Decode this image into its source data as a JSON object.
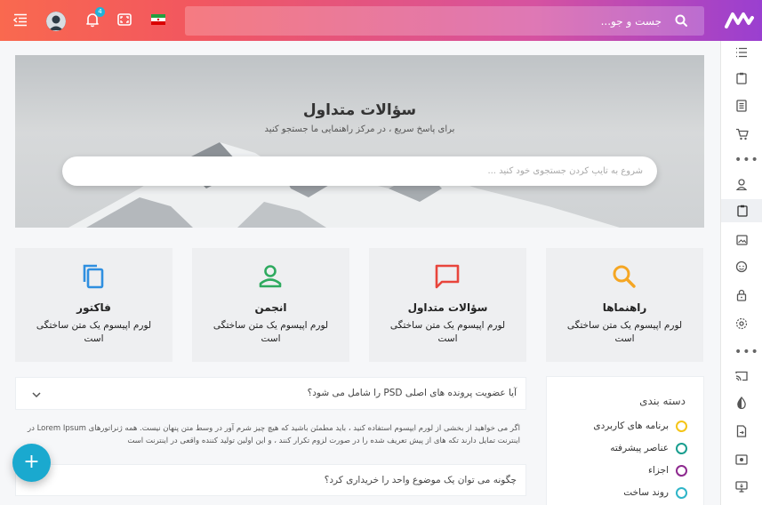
{
  "header": {
    "search_placeholder": "جست و جو...",
    "notification_count": "4",
    "colors": {
      "gradient_start": "#f9694f",
      "gradient_end": "#9a3fd0"
    },
    "icons": [
      "logo",
      "search-icon",
      "language-flag-iran",
      "fullscreen-icon",
      "bell-icon",
      "avatar",
      "menu-toggle-icon"
    ]
  },
  "sidebar": {
    "icons": [
      "list-icon",
      "clipboard-icon",
      "document-icon",
      "cart-icon",
      "more-dots",
      "user-icon",
      "clipboard-icon",
      "image-icon",
      "face-icon",
      "lock-icon",
      "settings-icon",
      "more-dots",
      "cast-icon",
      "contrast-icon",
      "file-export-icon",
      "card-icon",
      "monitor-icon"
    ],
    "active_index": 6
  },
  "hero": {
    "title": "سؤالات متداول",
    "subtitle": "برای پاسخ سریع ، در مرکز راهنمایی ما جستجو کنید",
    "search_placeholder": "شروع به تایپ کردن جستجوی خود کنید ..."
  },
  "cards": [
    {
      "title": "راهنماها",
      "text": "لورم اپیسوم یک متن ساختگی است",
      "icon": "search-icon",
      "color": "#f5a623"
    },
    {
      "title": "سؤالات متداول",
      "text": "لورم اپیسوم یک متن ساختگی است",
      "icon": "chat-icon",
      "color": "#e8453c"
    },
    {
      "title": "انجمن",
      "text": "لورم اپیسوم یک متن ساختگی است",
      "icon": "user-icon",
      "color": "#2eaa5f"
    },
    {
      "title": "فاکتور",
      "text": "لورم اپیسوم یک متن ساختگی است",
      "icon": "copy-icon",
      "color": "#2f8fe0"
    }
  ],
  "faq": [
    {
      "question": "آیا عضویت پرونده های اصلی PSD را شامل می شود؟",
      "answer": "اگر می خواهید از بخشی از لورم ایپسوم استفاده کنید ، باید مطمئن باشید که هیچ چیز شرم آور در وسط متن پنهان نیست. همه ژنراتورهای Lorem Ipsum در اینترنت تمایل دارند تکه های از پیش تعریف شده را در صورت لزوم تکرار کنند ، و این اولین تولید کننده واقعی در اینترنت است"
    },
    {
      "question": "چگونه می توان یک موضوع واحد را خریداری کرد؟"
    }
  ],
  "categories": {
    "title": "دسته بندی",
    "items": [
      {
        "label": "برنامه های کاربردی",
        "color": "#f5c518"
      },
      {
        "label": "عناصر پیشرفته",
        "color": "#1a9e8f"
      },
      {
        "label": "اجزاء",
        "color": "#8e2a8f"
      },
      {
        "label": "روند ساخت",
        "color": "#2fb5c8"
      }
    ]
  },
  "fab": {
    "label": "+"
  }
}
